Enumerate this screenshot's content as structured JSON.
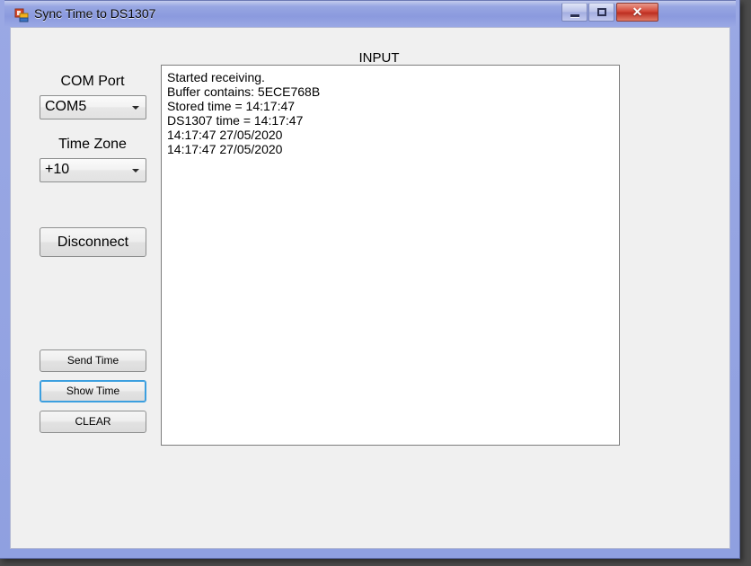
{
  "window": {
    "title": "Sync Time to DS1307",
    "icon": "winforms-app-icon",
    "controls": {
      "minimize": "minimize-icon",
      "maximize": "maximize-icon",
      "close_label": "✕"
    }
  },
  "form": {
    "input_header": "INPUT",
    "com_port": {
      "label": "COM Port",
      "value": "COM5"
    },
    "time_zone": {
      "label": "Time Zone",
      "value": "+10"
    },
    "buttons": {
      "disconnect": "Disconnect",
      "send_time": "Send Time",
      "show_time": "Show Time",
      "clear": "CLEAR"
    },
    "log": {
      "lines": [
        "Started receiving.",
        "Buffer contains: 5ECE768B",
        "Stored time = 14:17:47",
        "DS1307 time = 14:17:47",
        "14:17:47 27/05/2020",
        "14:17:47 27/05/2020"
      ]
    }
  },
  "colors": {
    "focus_ring": "#3c9fdf",
    "title_bar": "#8fa0e0",
    "client_background": "#f0f0f0",
    "close_button": "#d4493a"
  }
}
